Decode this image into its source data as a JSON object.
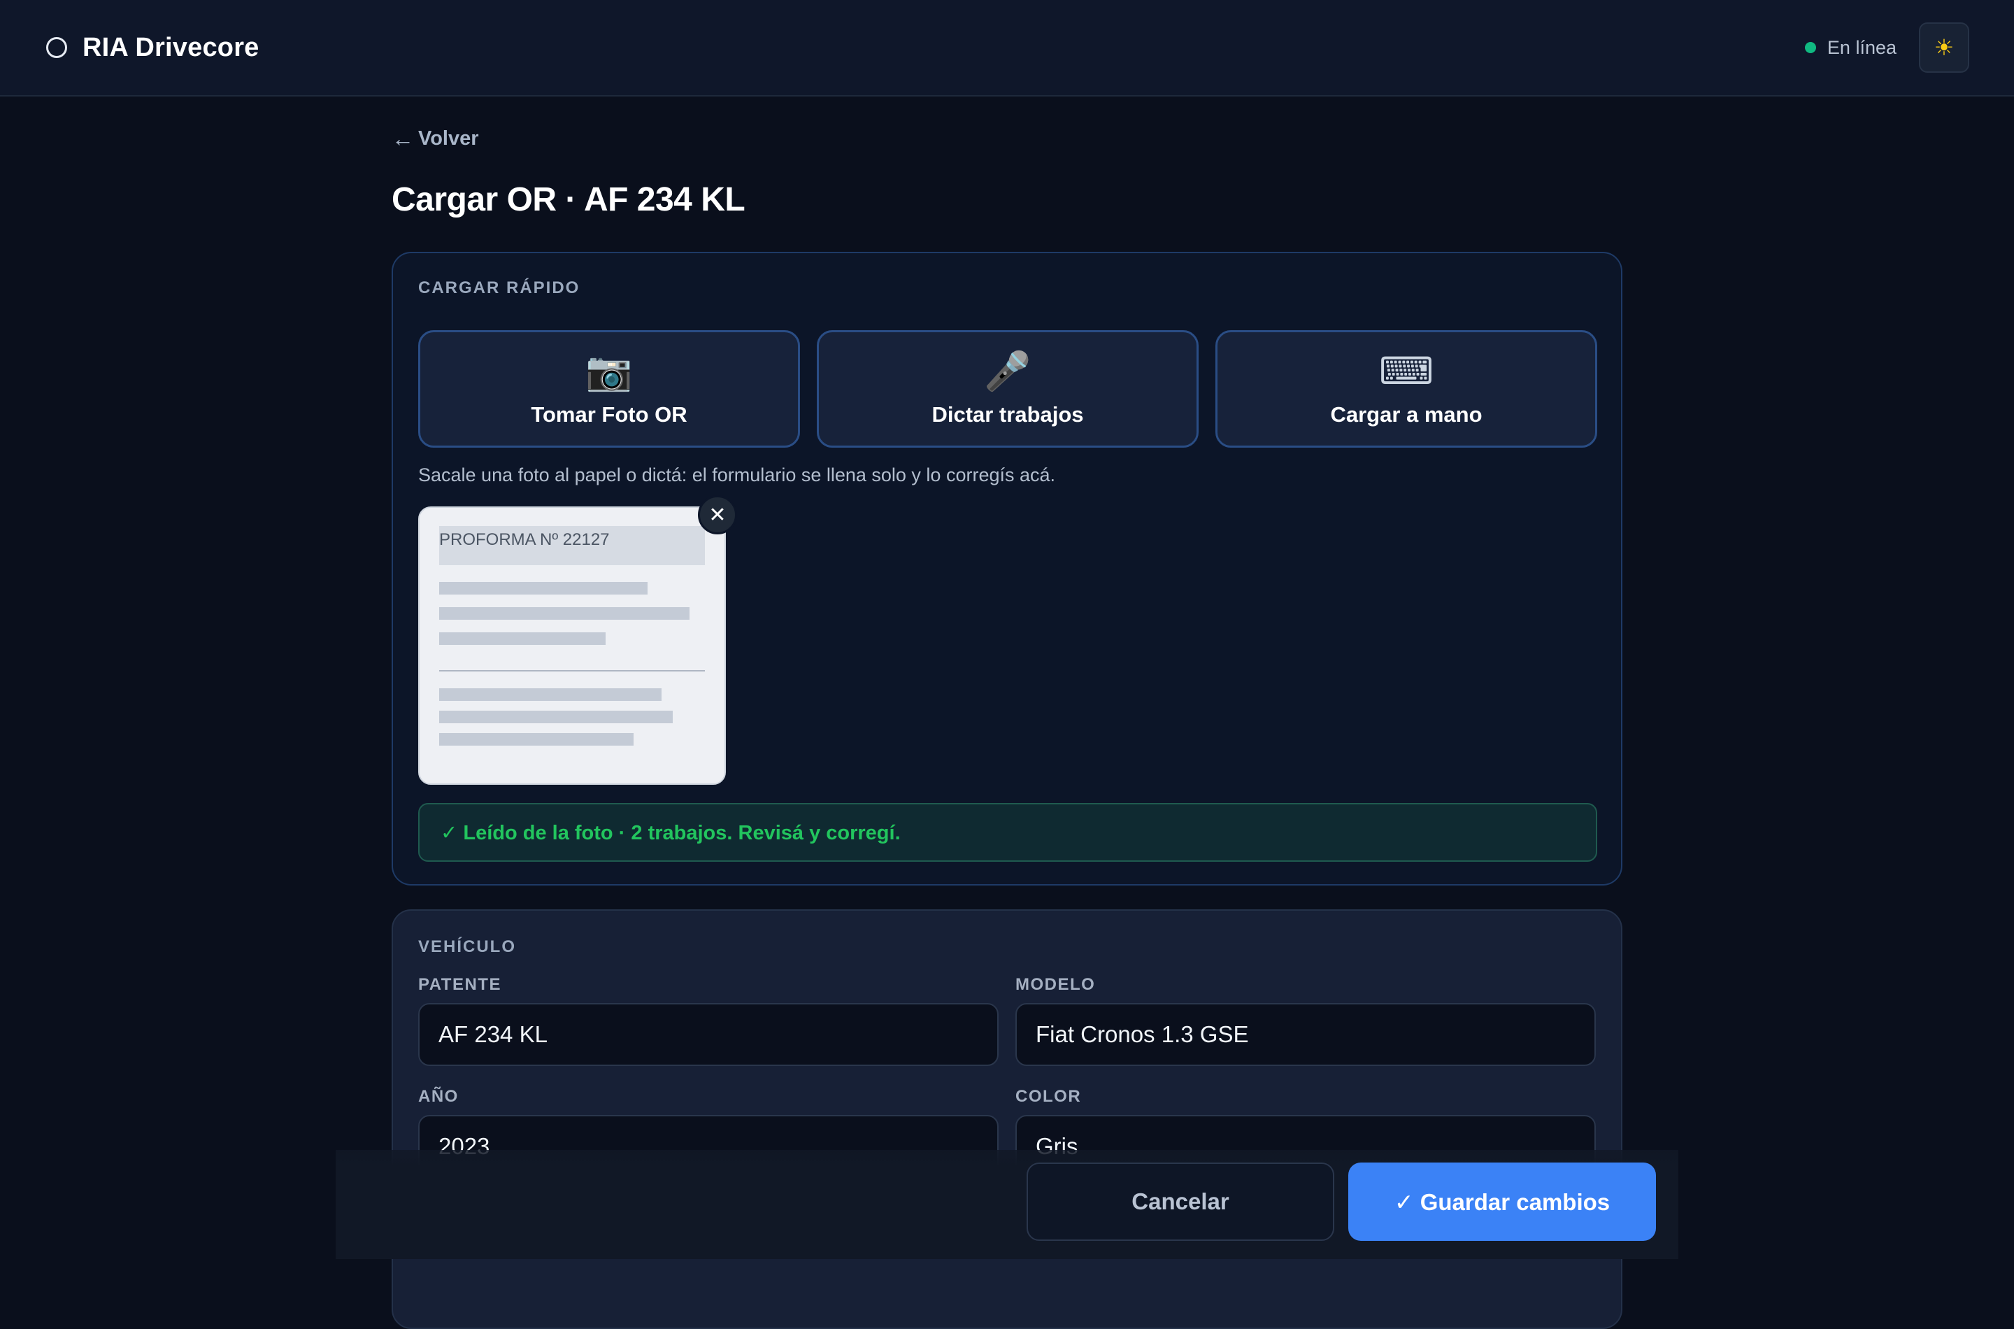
{
  "app": {
    "name": "RIA Drivecore",
    "status_text": "En línea",
    "status_color": "#10b981",
    "theme_icon": "sun-icon"
  },
  "nav": {
    "back_arrow": "←",
    "back_label": "Volver"
  },
  "page": {
    "title": "Cargar OR · AF 234 KL"
  },
  "quick_load": {
    "section_label": "CARGAR RÁPIDO",
    "options": [
      {
        "icon": "camera-icon",
        "glyph": "📷",
        "label": "Tomar Foto OR"
      },
      {
        "icon": "microphone-icon",
        "glyph": "🎤",
        "label": "Dictar trabajos"
      },
      {
        "icon": "keyboard-icon",
        "glyph": "⌨",
        "label": "Cargar a mano"
      }
    ],
    "hint": "Sacale una foto al papel o dictá: el formulario se llena solo y lo corregís acá.",
    "photo": {
      "header_text": "PROFORMA Nº 22127",
      "remove_glyph": "✕"
    },
    "result_message": "✓ Leído de la foto · 2 trabajos. Revisá y corregí."
  },
  "vehicle": {
    "section_label": "VEHÍCULO",
    "fields": {
      "patente": {
        "label": "PATENTE",
        "value": "AF 234 KL"
      },
      "modelo": {
        "label": "MODELO",
        "value": "Fiat Cronos 1.3 GSE"
      },
      "anio": {
        "label": "AÑO",
        "value": "2023"
      },
      "color": {
        "label": "COLOR",
        "value": "Gris"
      }
    }
  },
  "actions": {
    "cancel_label": "Cancelar",
    "save_label": "✓ Guardar cambios"
  },
  "colors": {
    "accent": "#3b82f6",
    "success": "#22c55e",
    "background": "#0a0f1c"
  }
}
